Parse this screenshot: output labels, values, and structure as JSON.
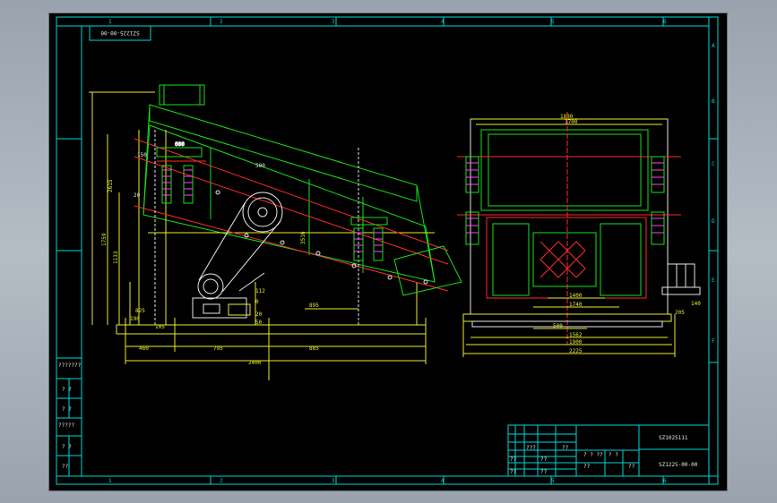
{
  "drawing": {
    "top_code": "SZ1225-00-00",
    "title_code": "SZ1025111",
    "drawing_no": "SZ1225-00-00"
  },
  "zones": {
    "columns": [
      "1",
      "2",
      "3",
      "4",
      "5",
      "6"
    ],
    "rows": [
      "A",
      "B",
      "C",
      "D",
      "E",
      "F"
    ]
  },
  "left_dims": {
    "overall_height": "2615",
    "h1": "1759",
    "h2": "1133",
    "h3": "825",
    "h4": "190",
    "h5": "105",
    "h6": "460",
    "w1": "795",
    "w2": "885",
    "w3": "2400",
    "w4": "895",
    "top_a": "600",
    "top_b": "150",
    "top_c": "20",
    "mid_a": "500",
    "angle": "3516",
    "small_a": "112",
    "small_b": "0",
    "small_c": "50",
    "small_d": "20"
  },
  "right_dims": {
    "top1": "1830",
    "top2": "1700",
    "bottom1": "1400",
    "bottom2": "1740",
    "bottom3": "500",
    "bottom4": "1562",
    "bottom5": "1900",
    "bottom6": "2225",
    "side1": "140",
    "side2": "205"
  },
  "left_notes": [
    "???????",
    "?  ?",
    "? ?",
    "?????",
    "? ?",
    "??"
  ],
  "title_block": {
    "row_labels": [
      "??",
      "???",
      "??",
      "??",
      "??",
      "??"
    ],
    "mass_label": "??",
    "scale_label": "??",
    "count_label": "? ? ??",
    "page_label": "? ?"
  }
}
